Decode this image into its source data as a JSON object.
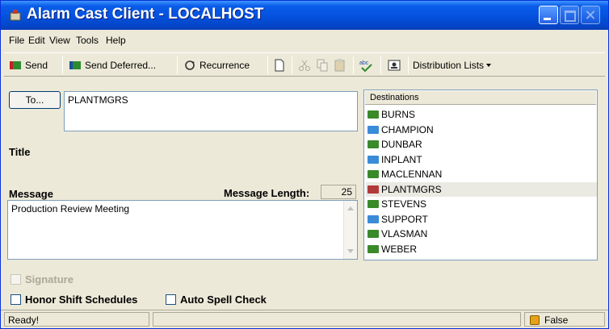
{
  "window": {
    "title": "Alarm Cast Client - LOCALHOST"
  },
  "menu": [
    {
      "label": "File"
    },
    {
      "label": "Edit"
    },
    {
      "label": "View"
    },
    {
      "label": "Tools"
    },
    {
      "label": "Help"
    }
  ],
  "toolbar": {
    "send": "Send",
    "send_deferred": "Send Deferred...",
    "recurrence": "Recurrence",
    "distribution_lists": "Distribution Lists"
  },
  "form": {
    "to_button": "To...",
    "to_value": "PLANTMGRS",
    "title_label": "Title",
    "message_label": "Message",
    "message_length_label": "Message Length:",
    "message_length_value": "25",
    "message_value": "Production Review Meeting"
  },
  "destinations": {
    "header": "Destinations",
    "items": [
      {
        "name": "BURNS",
        "icon": "pager-icon",
        "color": "#3a8a2a"
      },
      {
        "name": "CHAMPION",
        "icon": "group-icon",
        "color": "#3a8bd8"
      },
      {
        "name": "DUNBAR",
        "icon": "pager-icon",
        "color": "#3a8a2a"
      },
      {
        "name": "INPLANT",
        "icon": "group-icon",
        "color": "#3a8bd8"
      },
      {
        "name": "MACLENNAN",
        "icon": "pager-icon",
        "color": "#3a8a2a"
      },
      {
        "name": "PLANTMGRS",
        "icon": "list-icon",
        "color": "#b03a3a"
      },
      {
        "name": "STEVENS",
        "icon": "pager-icon",
        "color": "#3a8a2a"
      },
      {
        "name": "SUPPORT",
        "icon": "group-icon",
        "color": "#3a8bd8"
      },
      {
        "name": "VLASMAN",
        "icon": "pager-icon",
        "color": "#3a8a2a"
      },
      {
        "name": "WEBER",
        "icon": "pager-icon",
        "color": "#3a8a2a"
      }
    ],
    "selected": "PLANTMGRS"
  },
  "options": {
    "signature": "Signature",
    "honor_shift": "Honor Shift Schedules",
    "auto_spell": "Auto Spell Check"
  },
  "status": {
    "left": "Ready!",
    "right": "False"
  }
}
